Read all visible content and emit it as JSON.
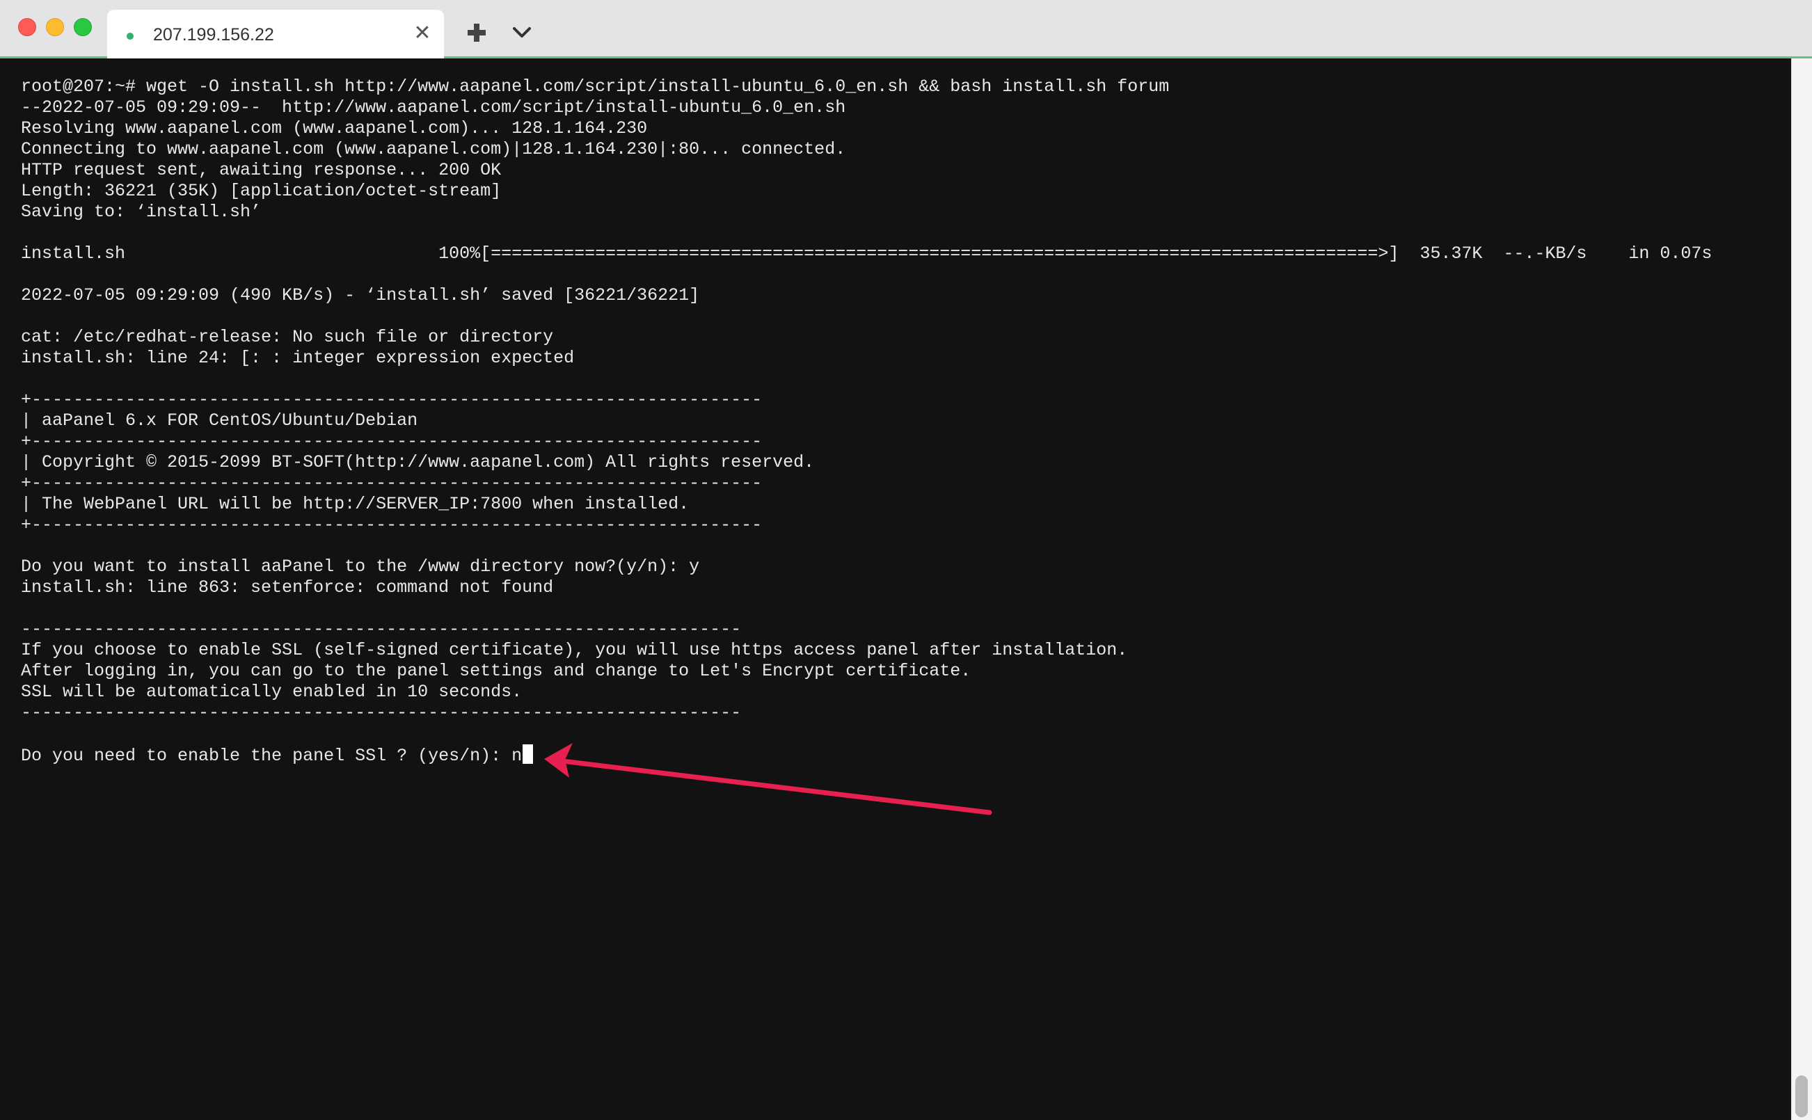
{
  "window": {
    "tab_title": "207.199.156.22",
    "close_label": "✕",
    "new_tab_label": "+",
    "accent_color": "#63c27a"
  },
  "terminal": {
    "lines": [
      "root@207:~# wget -O install.sh http://www.aapanel.com/script/install-ubuntu_6.0_en.sh && bash install.sh forum",
      "--2022-07-05 09:29:09--  http://www.aapanel.com/script/install-ubuntu_6.0_en.sh",
      "Resolving www.aapanel.com (www.aapanel.com)... 128.1.164.230",
      "Connecting to www.aapanel.com (www.aapanel.com)|128.1.164.230|:80... connected.",
      "HTTP request sent, awaiting response... 200 OK",
      "Length: 36221 (35K) [application/octet-stream]",
      "Saving to: ‘install.sh’",
      "",
      "install.sh                              100%[=====================================================================================>]  35.37K  --.-KB/s    in 0.07s",
      "",
      "2022-07-05 09:29:09 (490 KB/s) - ‘install.sh’ saved [36221/36221]",
      "",
      "cat: /etc/redhat-release: No such file or directory",
      "install.sh: line 24: [: : integer expression expected",
      "",
      "+----------------------------------------------------------------------",
      "| aaPanel 6.x FOR CentOS/Ubuntu/Debian",
      "+----------------------------------------------------------------------",
      "| Copyright © 2015-2099 BT-SOFT(http://www.aapanel.com) All rights reserved.",
      "+----------------------------------------------------------------------",
      "| The WebPanel URL will be http://SERVER_IP:7800 when installed.",
      "+----------------------------------------------------------------------",
      "",
      "Do you want to install aaPanel to the /www directory now?(y/n): y",
      "install.sh: line 863: setenforce: command not found",
      "",
      "---------------------------------------------------------------------",
      "If you choose to enable SSL (self-signed certificate), you will use https access panel after installation.",
      "After logging in, you can go to the panel settings and change to Let's Encrypt certificate.",
      "SSL will be automatically enabled in 10 seconds.",
      "---------------------------------------------------------------------",
      ""
    ],
    "prompt_line": "Do you need to enable the panel SSl ? (yes/n): n"
  },
  "annotation": {
    "arrow_color": "#e8204f"
  }
}
